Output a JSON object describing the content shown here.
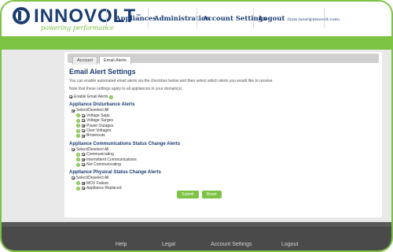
{
  "header": {
    "logo_text": "INNOVOLT",
    "logo_trademark": "™",
    "tagline": "powering performance",
    "nav": [
      "Appliances",
      "Administration",
      "Account Settings"
    ],
    "logout_label": "Logout",
    "logout_user": "(lynn.lazar@innovolt.com)"
  },
  "tabs": [
    "Account",
    "Email Alerts"
  ],
  "page": {
    "title": "Email Alert Settings",
    "intro": "You can enable automated email alerts via the checkbox below and then select which alerts you would like to receive.",
    "note": "Note that these settings apply to all appliances in your domain(s).",
    "enable_label": "Enable Email Alerts"
  },
  "sections": [
    {
      "title": "Appliance Disturbance Alerts",
      "select_all": "Select/Deselect All",
      "items": [
        "Voltage Sags",
        "Voltage Surges",
        "Power Outages",
        "Over Voltages",
        "Brownouts"
      ]
    },
    {
      "title": "Appliance Communications Status Change Alerts",
      "select_all": "Select/Deselect All",
      "items": [
        "Communicating",
        "Intermittent Communications",
        "Not Communicating"
      ]
    },
    {
      "title": "Appliance Physical Status Change Alerts",
      "select_all": "Select/Deselect All",
      "items": [
        "MOV Failure",
        "Appliance Replaced"
      ]
    }
  ],
  "buttons": {
    "submit": "Submit",
    "reset": "Reset"
  },
  "footer": [
    "Help",
    "Legal",
    "Account Settings",
    "Logout"
  ],
  "colors": {
    "brand_blue": "#1a3d72",
    "brand_green": "#7cc243",
    "footer": "#4a4a4a"
  },
  "icons": {
    "help": "question-mark-circle",
    "checkbox": "checked-checkbox"
  }
}
